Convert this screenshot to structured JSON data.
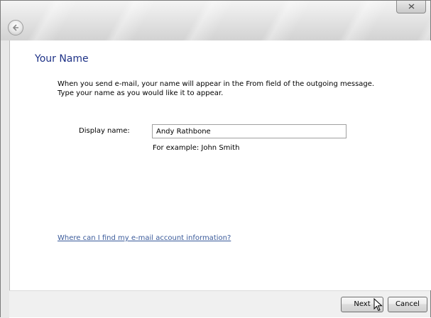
{
  "window": {
    "back_icon": "back-arrow-icon",
    "close_icon": "close-icon"
  },
  "page": {
    "title": "Your Name",
    "instruction_line1": "When you send e-mail, your name will appear in the From field of the outgoing message.",
    "instruction_line2": "Type your name as you would like it to appear."
  },
  "form": {
    "display_name_label": "Display name:",
    "display_name_value": "Andy Rathbone",
    "example_text": "For example: John Smith"
  },
  "help": {
    "link_text": "Where can I find my e-mail account information?"
  },
  "buttons": {
    "next_label": "Next",
    "cancel_label": "Cancel"
  }
}
